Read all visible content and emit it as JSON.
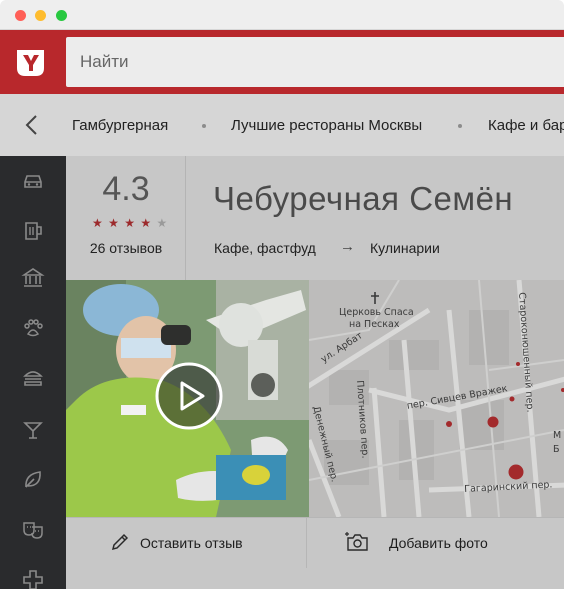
{
  "window": {
    "controls": [
      "close",
      "minimize",
      "maximize"
    ],
    "colors": [
      "#ff5f57",
      "#febc2e",
      "#28c840"
    ]
  },
  "header": {
    "logo": "yandex-y-logo",
    "search_placeholder": "Найти",
    "accent": "#b8282c"
  },
  "breadcrumbs": {
    "back_icon": "chevron-left-icon",
    "items": [
      "Гамбургерная",
      "Лучшие рестораны Москвы",
      "Кафе и бар"
    ]
  },
  "sidebar": {
    "icons": [
      "car-icon",
      "beer-mug-icon",
      "museum-icon",
      "paw-icon",
      "burger-icon",
      "cocktail-icon",
      "leaf-icon",
      "theater-masks-icon",
      "medical-cross-icon"
    ]
  },
  "place": {
    "rating": "4.3",
    "stars_filled": 4,
    "stars_total": 5,
    "reviews": "26 отзывов",
    "title": "Чебуречная Семён",
    "category": "Кафе, фастфуд",
    "arrow": "→",
    "category_related": "Кулинарии"
  },
  "media": {
    "video_icon": "play-icon"
  },
  "map": {
    "labels": [
      "Церковь Спаса",
      "на Песках",
      "ул. Арбат",
      "Плотников пер.",
      "пер. Сивцев Вражек",
      "Денежный пер.",
      "Гагаринский пер.",
      "Староконюшенный пер.",
      "М",
      "Б"
    ]
  },
  "actions": {
    "review_label": "Оставить отзыв",
    "photo_label": "Добавить фото"
  }
}
